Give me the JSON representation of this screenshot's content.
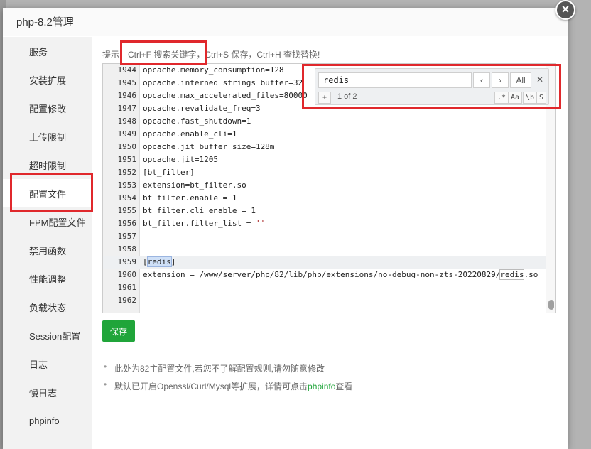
{
  "modal": {
    "title": "php-8.2管理",
    "close": "×"
  },
  "sidebar": {
    "items": [
      {
        "label": "服务"
      },
      {
        "label": "安装扩展"
      },
      {
        "label": "配置修改"
      },
      {
        "label": "上传限制"
      },
      {
        "label": "超时限制"
      },
      {
        "label": "配置文件"
      },
      {
        "label": "FPM配置文件"
      },
      {
        "label": "禁用函数"
      },
      {
        "label": "性能调整"
      },
      {
        "label": "负载状态"
      },
      {
        "label": "Session配置"
      },
      {
        "label": "日志"
      },
      {
        "label": "慢日志"
      },
      {
        "label": "phpinfo"
      }
    ],
    "active_index": 5
  },
  "hint": {
    "prefix": "提示：",
    "shortcut": "Ctrl+F 搜索关键字，",
    "rest": "Ctrl+S 保存，Ctrl+H 查找替换!"
  },
  "editor": {
    "lines": [
      {
        "n": "1944",
        "text": "opcache.memory_consumption=128"
      },
      {
        "n": "1945",
        "text": "opcache.interned_strings_buffer=32"
      },
      {
        "n": "1946",
        "text": "opcache.max_accelerated_files=80000"
      },
      {
        "n": "1947",
        "text": "opcache.revalidate_freq=3"
      },
      {
        "n": "1948",
        "text": "opcache.fast_shutdown=1"
      },
      {
        "n": "1949",
        "text": "opcache.enable_cli=1"
      },
      {
        "n": "1950",
        "text": "opcache.jit_buffer_size=128m"
      },
      {
        "n": "1951",
        "text": "opcache.jit=1205"
      },
      {
        "n": "1952",
        "text": "[bt_filter]"
      },
      {
        "n": "1953",
        "text": "extension=bt_filter.so"
      },
      {
        "n": "1954",
        "text": "bt_filter.enable = 1"
      },
      {
        "n": "1955",
        "text": "bt_filter.cli_enable = 1"
      },
      {
        "n": "1956",
        "text": "bt_filter.filter_list = "
      },
      {
        "n": "1957",
        "text": ""
      },
      {
        "n": "1958",
        "text": ""
      },
      {
        "n": "1959",
        "text": "redis"
      },
      {
        "n": "1960",
        "text": "extension = /www/server/php/82/lib/php/extensions/no-debug-non-zts-20220829/"
      },
      {
        "n": "1961",
        "text": ""
      },
      {
        "n": "1962",
        "text": ""
      }
    ],
    "filter_list_value": "''",
    "redis_ext_tail": "redis",
    "redis_ext_suffix": ".so",
    "bracket_open": "[",
    "bracket_close": "]"
  },
  "search": {
    "query": "redis",
    "prev": "‹",
    "next": "›",
    "all": "All",
    "close": "✕",
    "toggle_replace": "+",
    "count": "1 of 2",
    "opt_regex": ".*",
    "opt_case": "Aa",
    "opt_word": "\\b",
    "opt_selection": "S"
  },
  "actions": {
    "save": "保存"
  },
  "notes": {
    "n1": "此处为82主配置文件,若您不了解配置规则,请勿随意修改",
    "n2_prefix": "默认已开启Openssl/Curl/Mysql等扩展，详情可点击",
    "n2_link": "phpinfo",
    "n2_suffix": "查看"
  },
  "colors": {
    "accent": "#20a53a",
    "highlight_box": "#e0282c"
  }
}
